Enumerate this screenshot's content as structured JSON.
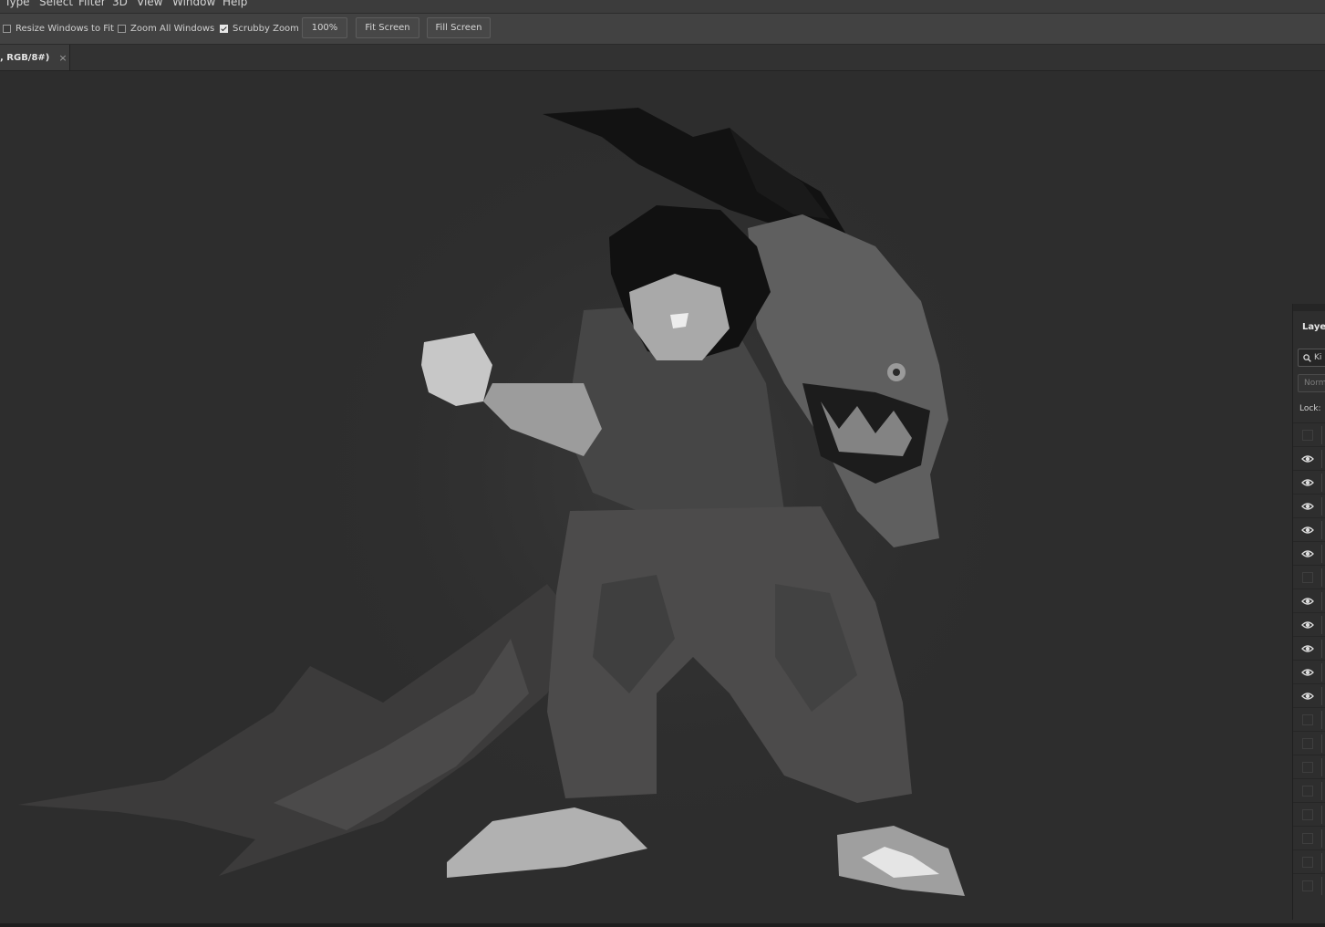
{
  "menubar": {
    "items": [
      "Type",
      "Select",
      "Filter",
      "3D",
      "View",
      "Window",
      "Help"
    ]
  },
  "options": {
    "resize_windows_label": "Resize Windows to Fit",
    "resize_windows_checked": false,
    "zoom_all_label": "Zoom All Windows",
    "zoom_all_checked": false,
    "scrubby_zoom_label": "Scrubby Zoom",
    "scrubby_zoom_checked": true,
    "zoom_value": "100%",
    "fit_screen_label": "Fit Screen",
    "fill_screen_label": "Fill Screen"
  },
  "document": {
    "tab_title": ", RGB/8#)",
    "close_glyph": "×"
  },
  "layers_panel": {
    "title": "Layers",
    "filter_value": "Ki",
    "blend_mode": "Norm",
    "lock_label": "Lock:",
    "visibility": [
      false,
      true,
      true,
      true,
      true,
      true,
      false,
      true,
      true,
      true,
      true,
      true,
      false,
      false,
      false,
      false,
      false,
      false,
      false,
      false
    ]
  },
  "icons": {
    "visibility": "eye-icon",
    "search": "search-icon",
    "close": "close-icon"
  },
  "colors": {
    "canvas_bg": "#2d2d2d",
    "panel_bg": "#2e2e2e",
    "toolbar_bg": "#424242"
  }
}
